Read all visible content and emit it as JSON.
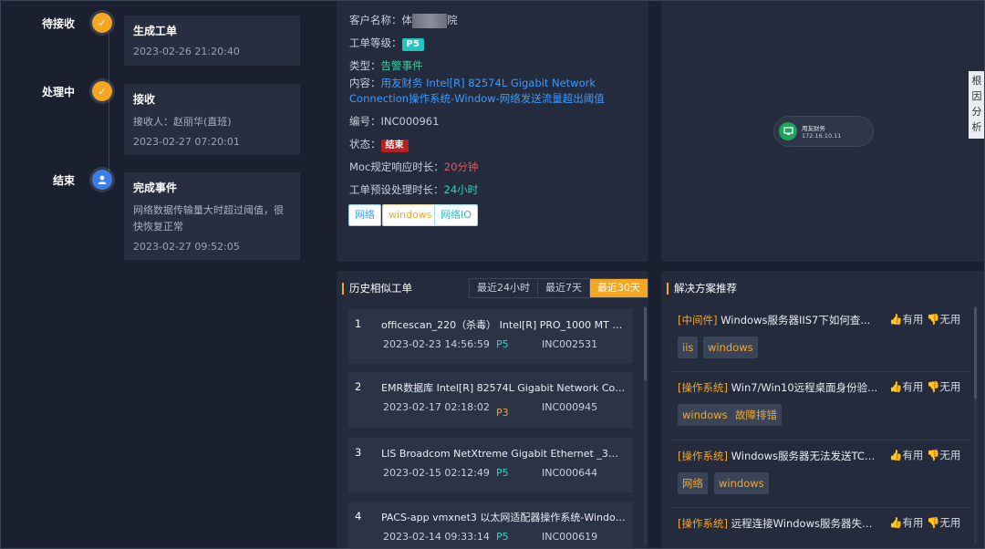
{
  "timeline": [
    {
      "status": "待接收",
      "icon": "check-icon",
      "title": "生成工单",
      "text": "",
      "date": "2023-02-26 21:20:40"
    },
    {
      "status": "处理中",
      "icon": "check-icon",
      "title": "接收",
      "text": "接收人：赵丽华(直班)",
      "date": "2023-02-27 07:20:01"
    },
    {
      "status": "结束",
      "icon": "user-icon",
      "title": "完成事件",
      "text": "网络数据传输量大时超过阈值，很快恢复正常",
      "date": "2023-02-27 09:52:05"
    }
  ],
  "ticket": {
    "customer_label": "客户名称：",
    "customer_value_a": "体",
    "customer_value_b": "院",
    "level_label": "工单等级：",
    "level_value": "P5",
    "type_label": "类型：",
    "type_value": "告警事件",
    "content_label": "内容：",
    "content_value": "用友财务 Intel[R] 82574L Gigabit Network Connection操作系统-Window-网络发送流量超出阈值",
    "number_label": "编号：",
    "number_value": "INC000961",
    "state_label": "状态：",
    "state_value": "结束",
    "moc_label": "Moc规定响应时长：",
    "moc_value": "20分钟",
    "plan_label": "工单预设处理时长：",
    "plan_value": "24小时",
    "tags": [
      "网络",
      "windows",
      "网络IO"
    ]
  },
  "topology": {
    "node_name": "用友财务",
    "node_ip": "172.16.10.11",
    "root_cause_tab": "根因分析"
  },
  "history": {
    "title": "历史相似工单",
    "tabs": [
      "最近24小时",
      "最近7天",
      "最近30天"
    ],
    "active_tab": "最近30天",
    "items": [
      {
        "idx": "1",
        "title": "officescan_220（杀毒） Intel[R] PRO_1000 MT Network...",
        "date": "2023-02-23 14:56:59",
        "level": "P5",
        "inc": "INC002531"
      },
      {
        "idx": "2",
        "title": "EMR数据库 Intel[R] 82574L Gigabit Network Connection...",
        "date": "2023-02-17 02:18:02",
        "level": "P3",
        "inc": "INC000945"
      },
      {
        "idx": "3",
        "title": "LIS Broadcom NetXtreme Gigabit Ethernet _3操作系统-...",
        "date": "2023-02-15 02:12:49",
        "level": "P5",
        "inc": "INC000644"
      },
      {
        "idx": "4",
        "title": "PACS-app vmxnet3 以太网适配器操作系统-Window-网...",
        "date": "2023-02-14 09:33:14",
        "level": "P5",
        "inc": "INC000619"
      }
    ]
  },
  "solutions": {
    "title": "解决方案推荐",
    "useful": "有用",
    "useless": "无用",
    "items": [
      {
        "cat": "[中间件]",
        "title": " Windows服务器IIS7下如何查...",
        "tags": [
          "iis",
          "windows"
        ]
      },
      {
        "cat": "[操作系统]",
        "title": " Win7/Win10远程桌面身份验...",
        "tags": [
          "windows",
          "故障排错"
        ]
      },
      {
        "cat": "[操作系统]",
        "title": " Windows服务器无法发送TCP...",
        "tags": [
          "网络",
          "windows"
        ]
      },
      {
        "cat": "[操作系统]",
        "title": " 远程连接Windows服务器失败...",
        "tags": []
      }
    ]
  },
  "colors": {
    "accent": "#f5a623",
    "link": "#3d9bff",
    "success": "#2fd3a4",
    "danger": "#b32020"
  }
}
